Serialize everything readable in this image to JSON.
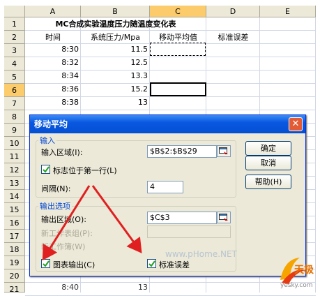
{
  "spreadsheet": {
    "columns": [
      "A",
      "B",
      "C",
      "D",
      "E"
    ],
    "rows": [
      "1",
      "2",
      "3",
      "4",
      "5",
      "6",
      "7",
      "8",
      "9",
      "10",
      "11",
      "12",
      "13",
      "14",
      "15",
      "16",
      "17",
      "18",
      "19",
      "20",
      "21"
    ],
    "title": "MC合成实验温度压力随温度变化表",
    "headers": {
      "time": "时间",
      "pressure": "系统压力/Mpa",
      "moving_avg": "移动平均值",
      "std_err": "标准误差"
    },
    "data": [
      {
        "time": "8:30",
        "pressure": "11.5"
      },
      {
        "time": "8:32",
        "pressure": "12.5"
      },
      {
        "time": "8:34",
        "pressure": "13.3"
      },
      {
        "time": "8:36",
        "pressure": "15.2"
      },
      {
        "time": "8:38",
        "pressure": "13"
      }
    ],
    "bottom_partial": {
      "time": "8:40",
      "pressure": "13"
    }
  },
  "dialog": {
    "title": "移动平均",
    "close_glyph": "✕",
    "input_group_title": "输入",
    "input_range_label": "输入区域(I):",
    "input_range_value": "$B$2:$B$29",
    "labels_first_row_label": "标志位于第一行(L)",
    "labels_first_row_checked": true,
    "interval_label": "间隔(N):",
    "interval_value": "4",
    "output_group_title": "输出选项",
    "output_range_label": "输出区域(O):",
    "output_range_value": "$C$3",
    "new_sheet_label": "新工作表组(P):",
    "new_workbook_label": "新工作簿(W)",
    "chart_output_label": "图表输出(C)",
    "chart_output_checked": true,
    "std_errors_label": "标准误差",
    "std_errors_checked": true,
    "ok_label": "确定",
    "cancel_label": "取消",
    "help_label": "帮助(H)"
  },
  "watermark": "www.pHome.NET",
  "logo": {
    "brand": "天极",
    "site": "yesky.com"
  },
  "colors": {
    "title_bar": "#0a58e0",
    "dialog_bg": "#ece9d8",
    "arrow": "#e02020",
    "header_active": "#fccc6c"
  }
}
